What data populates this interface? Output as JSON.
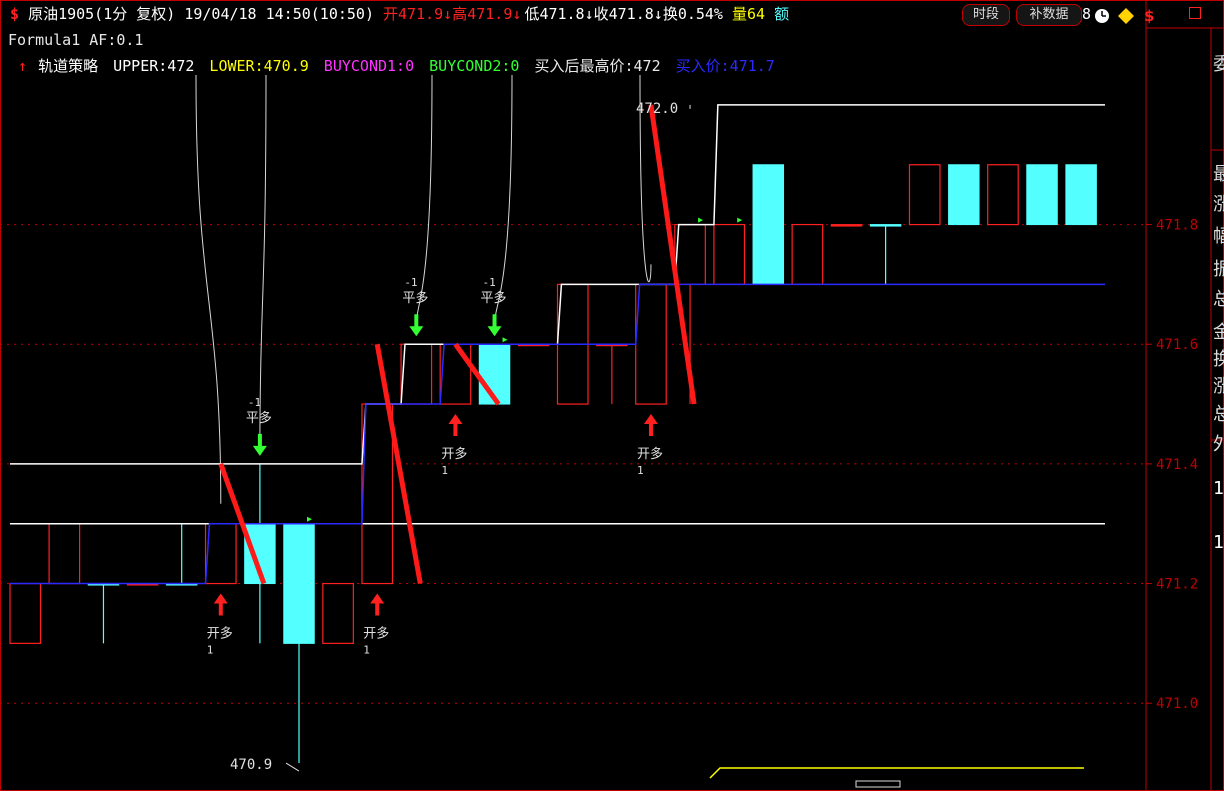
{
  "header": {
    "dollar_icon": "$",
    "symbol": "原油1905(1分 复权)",
    "datetime": "19/04/18 14:50(10:50)",
    "open": "开471.9↓",
    "high": "高471.9↓",
    "low": "低471.8↓",
    "close": "收471.8↓",
    "turnover": "换0.54%",
    "volume": "量64",
    "amount_partial": "额",
    "tail_partial": "8",
    "btn_period": "时段",
    "btn_fill_data": "补数据"
  },
  "formula_line": "Formula1 AF:0.1",
  "indicator": {
    "arrow": "↑",
    "name": "轨道策略",
    "upper": "UPPER:472",
    "lower": "LOWER:470.9",
    "buycond1": "BUYCOND1:0",
    "buycond2": "BUYCOND2:0",
    "max_after_buy": "买入后最高价:472",
    "buy_price": "买入价:471.7"
  },
  "right_strip": [
    "委",
    "最",
    "涨",
    "幅",
    "振",
    "总",
    "金",
    "换",
    "涨",
    "总",
    "外",
    "1",
    "1"
  ],
  "colors": {
    "up": "#ff2020",
    "down": "#54ffff",
    "upper_line": "#ffffff",
    "buy_line": "#2a2aff",
    "sell_line": "#ff1a1a",
    "grid": "#c00000",
    "signal_buy": "#ff2020",
    "signal_sell": "#33ff33",
    "lower_line": "#ffff00"
  },
  "chart_data": {
    "type": "candlestick",
    "ylim": [
      470.88,
      472.05
    ],
    "y_ticks": [
      471.0,
      471.2,
      471.4,
      471.6,
      471.8
    ],
    "y_tick_labels": [
      "471.0",
      "471.2",
      "471.4",
      "471.6",
      "471.8"
    ],
    "candles": [
      {
        "o": 471.1,
        "h": 471.2,
        "l": 471.1,
        "c": 471.2
      },
      {
        "o": 471.2,
        "h": 471.3,
        "l": 471.2,
        "c": 471.3
      },
      {
        "o": 471.2,
        "h": 471.2,
        "l": 471.1,
        "c": 471.2
      },
      {
        "o": 471.2,
        "h": 471.2,
        "l": 471.2,
        "c": 471.2
      },
      {
        "o": 471.2,
        "h": 471.3,
        "l": 471.2,
        "c": 471.2
      },
      {
        "o": 471.2,
        "h": 471.3,
        "l": 471.2,
        "c": 471.3
      },
      {
        "o": 471.3,
        "h": 471.4,
        "l": 471.1,
        "c": 471.2
      },
      {
        "o": 471.3,
        "h": 471.3,
        "l": 470.9,
        "c": 471.1
      },
      {
        "o": 471.1,
        "h": 471.2,
        "l": 471.1,
        "c": 471.2
      },
      {
        "o": 471.2,
        "h": 471.5,
        "l": 471.2,
        "c": 471.5
      },
      {
        "o": 471.5,
        "h": 471.6,
        "l": 471.5,
        "c": 471.6
      },
      {
        "o": 471.5,
        "h": 471.6,
        "l": 471.5,
        "c": 471.6
      },
      {
        "o": 471.6,
        "h": 471.6,
        "l": 471.5,
        "c": 471.5
      },
      {
        "o": 471.6,
        "h": 471.6,
        "l": 471.6,
        "c": 471.6
      },
      {
        "o": 471.5,
        "h": 471.7,
        "l": 471.5,
        "c": 471.7
      },
      {
        "o": 471.6,
        "h": 471.6,
        "l": 471.5,
        "c": 471.6
      },
      {
        "o": 471.5,
        "h": 471.7,
        "l": 471.5,
        "c": 471.7
      },
      {
        "o": 471.7,
        "h": 471.8,
        "l": 471.5,
        "c": 471.8
      },
      {
        "o": 471.7,
        "h": 471.8,
        "l": 471.7,
        "c": 471.8
      },
      {
        "o": 471.9,
        "h": 471.9,
        "l": 471.7,
        "c": 471.7
      },
      {
        "o": 471.7,
        "h": 471.8,
        "l": 471.7,
        "c": 471.8
      },
      {
        "o": 471.8,
        "h": 471.8,
        "l": 471.8,
        "c": 471.8
      },
      {
        "o": 471.8,
        "h": 471.8,
        "l": 471.7,
        "c": 471.8
      },
      {
        "o": 471.8,
        "h": 471.9,
        "l": 471.8,
        "c": 471.9
      },
      {
        "o": 471.9,
        "h": 471.9,
        "l": 471.8,
        "c": 471.8
      },
      {
        "o": 471.8,
        "h": 471.9,
        "l": 471.8,
        "c": 471.9
      },
      {
        "o": 471.9,
        "h": 471.9,
        "l": 471.8,
        "c": 471.8
      },
      {
        "o": 471.9,
        "h": 471.9,
        "l": 471.8,
        "c": 471.8
      }
    ],
    "upper_line": [
      471.4,
      471.4,
      471.4,
      471.4,
      471.4,
      471.4,
      471.4,
      471.4,
      471.4,
      471.5,
      471.6,
      471.6,
      471.6,
      471.6,
      471.7,
      471.7,
      471.7,
      471.8,
      472.0,
      472.0,
      472.0,
      472.0,
      472.0,
      472.0,
      472.0,
      472.0,
      472.0,
      472.0
    ],
    "lower_line": [
      471.3,
      471.3,
      471.3,
      471.3,
      471.3,
      471.3,
      471.3,
      471.3,
      471.3,
      471.3,
      471.3,
      471.3,
      471.3,
      471.3,
      471.3,
      471.3,
      471.3,
      471.3,
      471.3,
      471.3,
      471.3,
      471.3,
      471.3,
      471.3,
      471.3,
      471.3,
      471.3,
      471.3
    ],
    "buy_line": [
      471.2,
      471.2,
      471.2,
      471.2,
      471.2,
      471.3,
      471.3,
      471.3,
      471.3,
      471.5,
      471.5,
      471.6,
      471.6,
      471.6,
      471.6,
      471.6,
      471.7,
      471.7,
      471.7,
      471.7,
      471.7,
      471.7,
      471.7,
      471.7,
      471.7,
      471.7,
      471.7,
      471.7
    ],
    "buy_signals": [
      {
        "i": 5,
        "label": "开多",
        "count": "1"
      },
      {
        "i": 9,
        "label": "开多",
        "count": "1"
      },
      {
        "i": 11,
        "label": "开多",
        "count": "1"
      },
      {
        "i": 16,
        "label": "开多",
        "count": "1"
      }
    ],
    "sell_signals": [
      {
        "i": 6,
        "label": "平多",
        "count": "-1"
      },
      {
        "i": 10,
        "label": "平多",
        "count": "-1"
      },
      {
        "i": 12,
        "label": "平多",
        "count": "-1"
      }
    ],
    "annotations": {
      "high_label": "472.0",
      "low_label": "470.9"
    }
  }
}
